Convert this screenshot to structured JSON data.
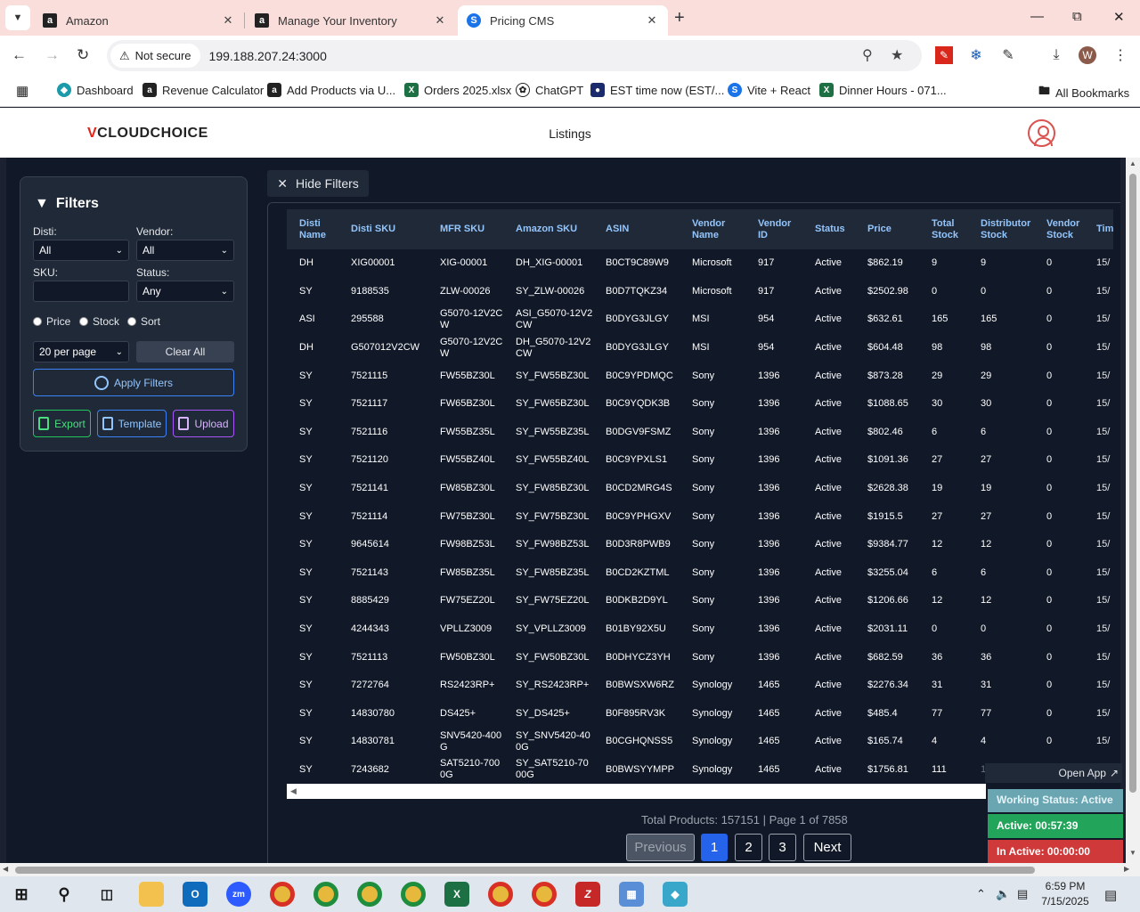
{
  "browser": {
    "tabs": [
      {
        "title": "Amazon",
        "favicon": "amazon-icon"
      },
      {
        "title": "Manage Your Inventory",
        "favicon": "amazon-icon"
      },
      {
        "title": "Pricing CMS",
        "favicon": "pricing-cms-icon"
      }
    ],
    "security_label": "Not secure",
    "url": "199.188.207.24:3000",
    "profile_initial": "W",
    "bookmarks": [
      "Dashboard",
      "Revenue Calculator",
      "Add Products via U...",
      "Orders 2025.xlsx",
      "ChatGPT",
      "EST time now (EST/...",
      "Vite + React",
      "Dinner Hours - 071..."
    ],
    "all_bookmarks": "All Bookmarks"
  },
  "app": {
    "logo_prefix": "V",
    "logo_brand": "CLOUDCHOICE",
    "page_title": "Listings"
  },
  "filters": {
    "heading": "Filters",
    "disti_label": "Disti:",
    "disti_value": "All",
    "vendor_label": "Vendor:",
    "vendor_value": "All",
    "sku_label": "SKU:",
    "sku_value": "",
    "status_label": "Status:",
    "status_value": "Any",
    "radio_options": [
      "Price",
      "Stock",
      "Sort"
    ],
    "per_page": "20 per page",
    "clear_all": "Clear All",
    "apply": "Apply Filters",
    "export": "Export",
    "template": "Template",
    "upload": "Upload"
  },
  "hide_filters": "Hide Filters",
  "table": {
    "headers": [
      "Disti Name",
      "Disti SKU",
      "MFR SKU",
      "Amazon SKU",
      "ASIN",
      "Vendor Name",
      "Vendor ID",
      "Status",
      "Price",
      "Total Stock",
      "Distributor Stock",
      "Vendor Stock",
      "Tim"
    ],
    "rows": [
      [
        "DH",
        "XIG00001",
        "XIG-00001",
        "DH_XIG-00001",
        "B0CT9C89W9",
        "Microsoft",
        "917",
        "Active",
        "$862.19",
        "9",
        "9",
        "0",
        "15/"
      ],
      [
        "SY",
        "9188535",
        "ZLW-00026",
        "SY_ZLW-00026",
        "B0D7TQKZ34",
        "Microsoft",
        "917",
        "Active",
        "$2502.98",
        "0",
        "0",
        "0",
        "15/"
      ],
      [
        "ASI",
        "295588",
        "G5070-12V2CW",
        "ASI_G5070-12V2CW",
        "B0DYG3JLGY",
        "MSI",
        "954",
        "Active",
        "$632.61",
        "165",
        "165",
        "0",
        "15/"
      ],
      [
        "DH",
        "G507012V2CW",
        "G5070-12V2CW",
        "DH_G5070-12V2CW",
        "B0DYG3JLGY",
        "MSI",
        "954",
        "Active",
        "$604.48",
        "98",
        "98",
        "0",
        "15/"
      ],
      [
        "SY",
        "7521115",
        "FW55BZ30L",
        "SY_FW55BZ30L",
        "B0C9YPDMQC",
        "Sony",
        "1396",
        "Active",
        "$873.28",
        "29",
        "29",
        "0",
        "15/"
      ],
      [
        "SY",
        "7521117",
        "FW65BZ30L",
        "SY_FW65BZ30L",
        "B0C9YQDK3B",
        "Sony",
        "1396",
        "Active",
        "$1088.65",
        "30",
        "30",
        "0",
        "15/"
      ],
      [
        "SY",
        "7521116",
        "FW55BZ35L",
        "SY_FW55BZ35L",
        "B0DGV9FSMZ",
        "Sony",
        "1396",
        "Active",
        "$802.46",
        "6",
        "6",
        "0",
        "15/"
      ],
      [
        "SY",
        "7521120",
        "FW55BZ40L",
        "SY_FW55BZ40L",
        "B0C9YPXLS1",
        "Sony",
        "1396",
        "Active",
        "$1091.36",
        "27",
        "27",
        "0",
        "15/"
      ],
      [
        "SY",
        "7521141",
        "FW85BZ30L",
        "SY_FW85BZ30L",
        "B0CD2MRG4S",
        "Sony",
        "1396",
        "Active",
        "$2628.38",
        "19",
        "19",
        "0",
        "15/"
      ],
      [
        "SY",
        "7521114",
        "FW75BZ30L",
        "SY_FW75BZ30L",
        "B0C9YPHGXV",
        "Sony",
        "1396",
        "Active",
        "$1915.5",
        "27",
        "27",
        "0",
        "15/"
      ],
      [
        "SY",
        "9645614",
        "FW98BZ53L",
        "SY_FW98BZ53L",
        "B0D3R8PWB9",
        "Sony",
        "1396",
        "Active",
        "$9384.77",
        "12",
        "12",
        "0",
        "15/"
      ],
      [
        "SY",
        "7521143",
        "FW85BZ35L",
        "SY_FW85BZ35L",
        "B0CD2KZTML",
        "Sony",
        "1396",
        "Active",
        "$3255.04",
        "6",
        "6",
        "0",
        "15/"
      ],
      [
        "SY",
        "8885429",
        "FW75EZ20L",
        "SY_FW75EZ20L",
        "B0DKB2D9YL",
        "Sony",
        "1396",
        "Active",
        "$1206.66",
        "12",
        "12",
        "0",
        "15/"
      ],
      [
        "SY",
        "4244343",
        "VPLLZ3009",
        "SY_VPLLZ3009",
        "B01BY92X5U",
        "Sony",
        "1396",
        "Active",
        "$2031.11",
        "0",
        "0",
        "0",
        "15/"
      ],
      [
        "SY",
        "7521113",
        "FW50BZ30L",
        "SY_FW50BZ30L",
        "B0DHYCZ3YH",
        "Sony",
        "1396",
        "Active",
        "$682.59",
        "36",
        "36",
        "0",
        "15/"
      ],
      [
        "SY",
        "7272764",
        "RS2423RP+",
        "SY_RS2423RP+",
        "B0BWSXW6RZ",
        "Synology",
        "1465",
        "Active",
        "$2276.34",
        "31",
        "31",
        "0",
        "15/"
      ],
      [
        "SY",
        "14830780",
        "DS425+",
        "SY_DS425+",
        "B0F895RV3K",
        "Synology",
        "1465",
        "Active",
        "$485.4",
        "77",
        "77",
        "0",
        "15/"
      ],
      [
        "SY",
        "14830781",
        "SNV5420-400G",
        "SY_SNV5420-400G",
        "B0CGHQNSS5",
        "Synology",
        "1465",
        "Active",
        "$165.74",
        "4",
        "4",
        "0",
        "15/"
      ],
      [
        "SY",
        "7243682",
        "SAT5210-7000G",
        "SY_SAT5210-7000G",
        "B0BWSYYMPP",
        "Synology",
        "1465",
        "Active",
        "$1756.81",
        "111",
        "111",
        "0",
        "15/"
      ]
    ]
  },
  "pagination": {
    "summary": "Total Products: 157151 | Page 1 of 7858",
    "previous": "Previous",
    "pages": [
      "1",
      "2",
      "3"
    ],
    "next": "Next"
  },
  "work_status": {
    "open_app": "Open App",
    "status": "Working Status: Active",
    "active": "Active: 00:57:39",
    "inactive": "In Active: 00:00:00"
  },
  "taskbar": {
    "time": "6:59 PM",
    "date": "7/15/2025"
  },
  "colors": {
    "accent": "#2563eb",
    "header_text": "#93c5fd",
    "panel": "#1f2937",
    "background": "#111827",
    "brand_red": "#e2231a"
  }
}
